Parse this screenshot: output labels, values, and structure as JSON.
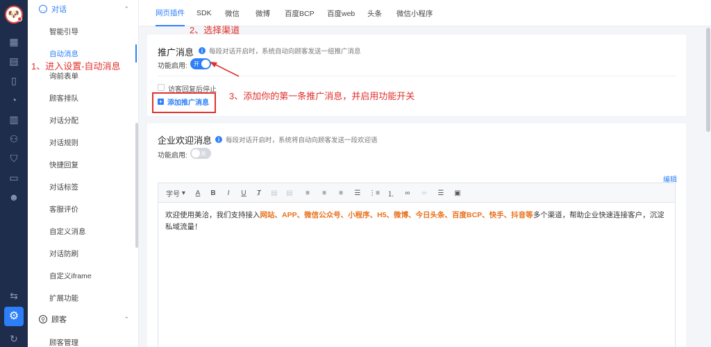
{
  "rail": {
    "icons": [
      "avatar",
      "dashboard-icon",
      "chat-icon",
      "clipboard-icon",
      "clock-icon",
      "bar-chart-icon",
      "users-icon",
      "shield-icon",
      "monitor-icon",
      "robot-icon",
      "transfer-icon",
      "gear-icon",
      "refresh-icon"
    ]
  },
  "subnav": {
    "group_dialog": "对话",
    "group_customer": "顾客",
    "items": [
      "智能引导",
      "自动消息",
      "询前表单",
      "顾客排队",
      "对话分配",
      "对话规则",
      "快捷回复",
      "对话标签",
      "客服评价",
      "自定义消息",
      "对话防刷",
      "自定义iframe",
      "扩展功能"
    ],
    "customer_items": [
      "顾客管理"
    ]
  },
  "tabs": [
    "网页插件",
    "SDK",
    "微信",
    "微博",
    "百度BCP",
    "百度web",
    "头条",
    "微信小程序"
  ],
  "promo": {
    "title": "推广消息",
    "tip": "每段对话开启时，系统自动向顾客发送一组推广消息",
    "enable_label": "功能启用:",
    "switch_text": "开",
    "stop_label": "访客回复后停止",
    "add_label": "添加推广消息"
  },
  "welcome": {
    "title": "企业欢迎消息",
    "tip": "每段对话开启时，系统将自动向顾客发送一段欢迎语",
    "enable_label": "功能启用:",
    "switch_text": "关",
    "edit_label": "编辑",
    "toolbar_font": "字号",
    "message_prefix": "欢迎使用美洽，我们支持接入",
    "message_channels": "网站、APP、微信公众号、小程序、H5、微博、今日头条、百度BCP、快手、抖音等",
    "message_suffix": "多个渠道，帮助企业快速连接客户，沉淀私域流量！"
  },
  "annotations": {
    "step1": "1、进入设置-自动消息",
    "step2": "2、选择渠道",
    "step3": "3、添加你的第一条推广消息，并启用功能开关"
  },
  "colors": {
    "accent": "#2d7ff9",
    "rail_bg": "#1f2d4d",
    "annotation": "#e0302c",
    "highlight": "#e8711c"
  }
}
